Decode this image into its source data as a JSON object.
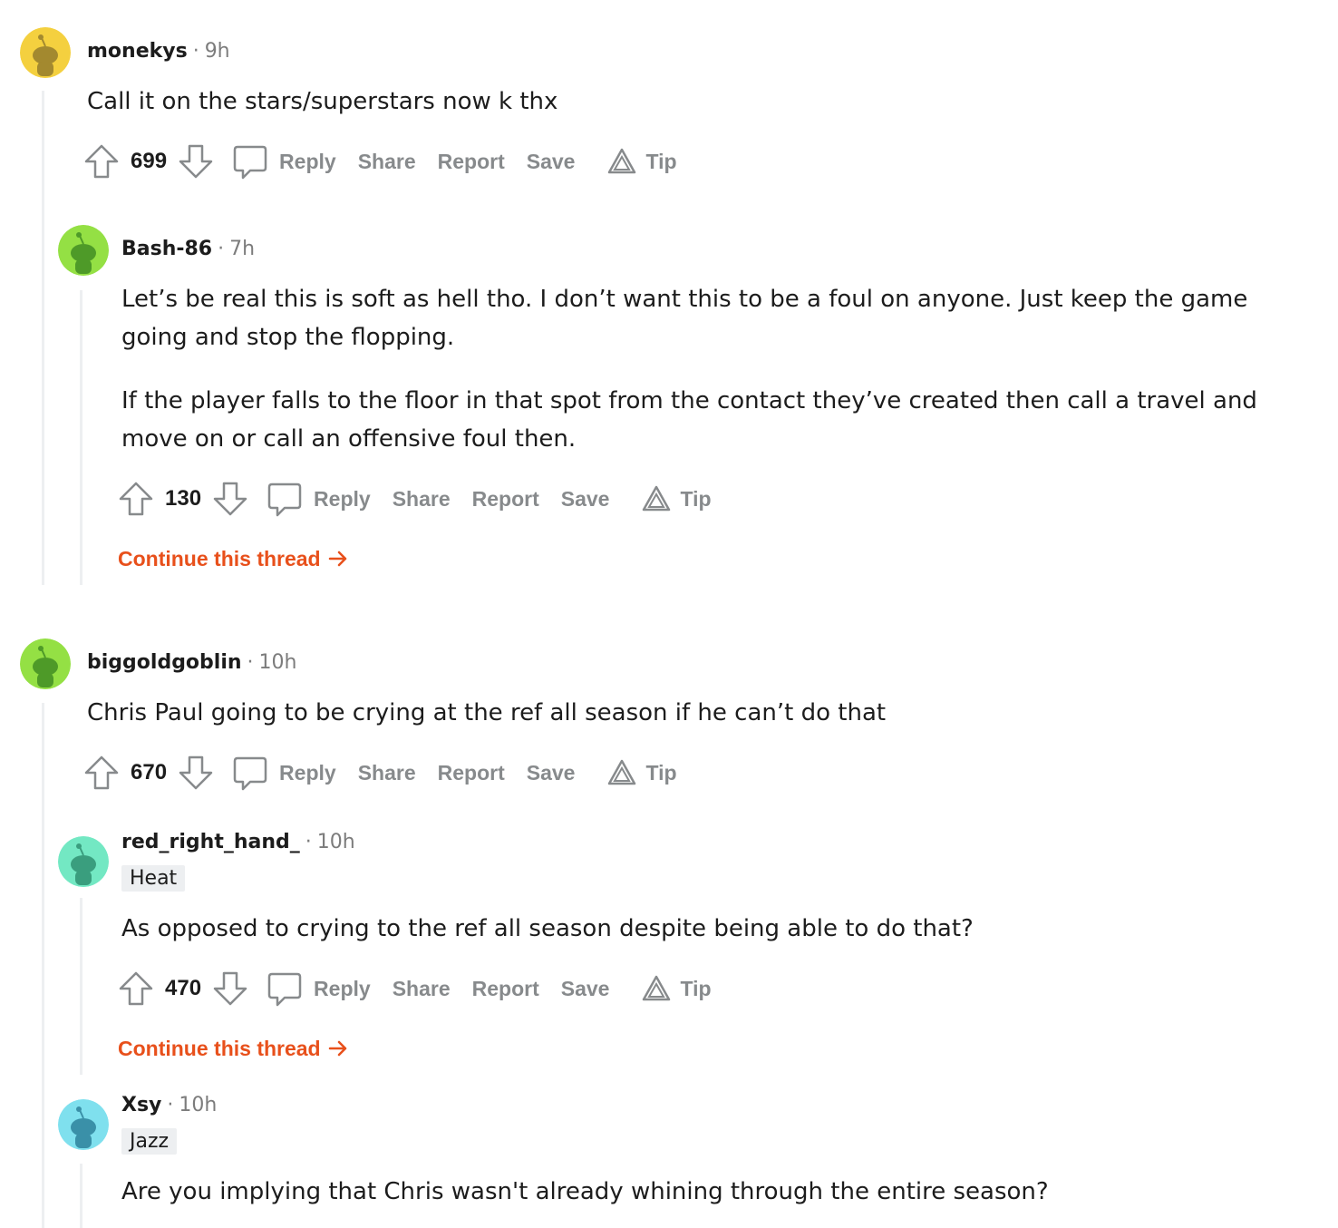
{
  "labels": {
    "reply": "Reply",
    "share": "Share",
    "report": "Report",
    "save": "Save",
    "tip": "Tip",
    "continue_thread": "Continue this thread",
    "separator": "·"
  },
  "icons": {
    "upvote": "arrow-up-icon",
    "downvote": "arrow-down-icon",
    "reply": "comment-bubble-icon",
    "tip": "tip-triangle-icon",
    "continue": "arrow-right-icon"
  },
  "colors": {
    "accent": "#e8501b",
    "muted": "#878a8c",
    "thread_line": "#edeff1"
  },
  "comments": [
    {
      "author": "monekys",
      "time": "9h",
      "avatar_color": "#f4d03f",
      "body": [
        "Call it on the stars/superstars now k thx"
      ],
      "score": "699"
    },
    {
      "author": "Bash-86",
      "time": "7h",
      "avatar_color": "#94e044",
      "body": [
        "Let’s be real this is soft as hell tho. I don’t want this to be a foul on anyone. Just keep the game going and stop the flopping.",
        "If the player falls to the floor in that spot from the contact they’ve created then call a travel and move on or call an offensive foul then."
      ],
      "score": "130"
    },
    {
      "author": "biggoldgoblin",
      "time": "10h",
      "avatar_color": "#94e044",
      "body": [
        "Chris Paul going to be crying at the ref all season if he can’t do that"
      ],
      "score": "670"
    },
    {
      "author": "red_right_hand_",
      "time": "10h",
      "flair": "Heat",
      "avatar_color": "#73e8c3",
      "body": [
        "As opposed to crying to the ref all season despite being able to do that?"
      ],
      "score": "470"
    },
    {
      "author": "Xsy",
      "time": "10h",
      "flair": "Jazz",
      "avatar_color": "#7fe0ee",
      "body": [
        "Are you implying that Chris wasn't already whining through the entire season?"
      ]
    }
  ]
}
